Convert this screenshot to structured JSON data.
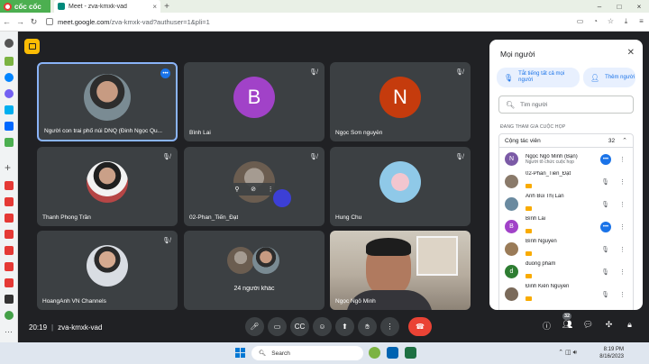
{
  "browser": {
    "brand": "cốc cốc",
    "tab_title": "Meet - zva-kmxk-vad",
    "url_host": "meet.google.com",
    "url_path": "/zva-kmxk-vad?authuser=1&pli=1"
  },
  "tiles": [
    {
      "name": "Người con trai phố núi DNQ (Đinh Ngọc Qu...",
      "type": "photo"
    },
    {
      "name": "Bình Lai",
      "initial": "B",
      "color": "#a142c8"
    },
    {
      "name": "Ngọc Sơn nguyễn",
      "initial": "N",
      "color": "#c53b0d"
    },
    {
      "name": "Thanh Phong Trần",
      "type": "photo"
    },
    {
      "name": "02-Phan_Tiến_Đạt",
      "type": "photo"
    },
    {
      "name": "Hung Chu",
      "type": "photo"
    },
    {
      "name": "HoangAnh VN Channels",
      "type": "photo"
    },
    {
      "name": "24 người khác",
      "type": "group"
    },
    {
      "name": "Ngọc Ngô Minh",
      "type": "self"
    }
  ],
  "bar": {
    "time": "20:19",
    "separator": "|",
    "meeting_code": "zva-kmxk-vad",
    "people_count": "32"
  },
  "panel": {
    "title": "Mọi người",
    "mute_all": "Tắt tiếng tất cả mọi người",
    "add_people": "Thêm người",
    "search_placeholder": "Tìm người",
    "section_label": "ĐANG THAM GIA CUỘC HỌP",
    "group_label": "Cộng tác viên",
    "group_count": "32",
    "people": [
      {
        "name": "Ngọc Ngô Minh (Bạn)",
        "sub": "Người tổ chức cuộc họp",
        "initial": "N",
        "color": "#7b5aa6"
      },
      {
        "name": "02-Phan_Tiến_Đạt",
        "sub": "",
        "initial": "",
        "color": "#8a7a6a"
      },
      {
        "name": "Anh Bùi Thị Lan",
        "sub": "",
        "initial": "",
        "color": "#6a8aa0"
      },
      {
        "name": "Bình Lai",
        "sub": "",
        "initial": "B",
        "color": "#a142c8"
      },
      {
        "name": "Bình Nguyễn",
        "sub": "",
        "initial": "",
        "color": "#9a7b58"
      },
      {
        "name": "duong pham",
        "sub": "",
        "initial": "d",
        "color": "#2e7d32"
      },
      {
        "name": "Đinh Kiên Nguyễn",
        "sub": "",
        "initial": "",
        "color": "#7a6a5a"
      }
    ]
  },
  "taskbar": {
    "search": "Search",
    "time": "8:19 PM",
    "date": "8/16/2023"
  }
}
